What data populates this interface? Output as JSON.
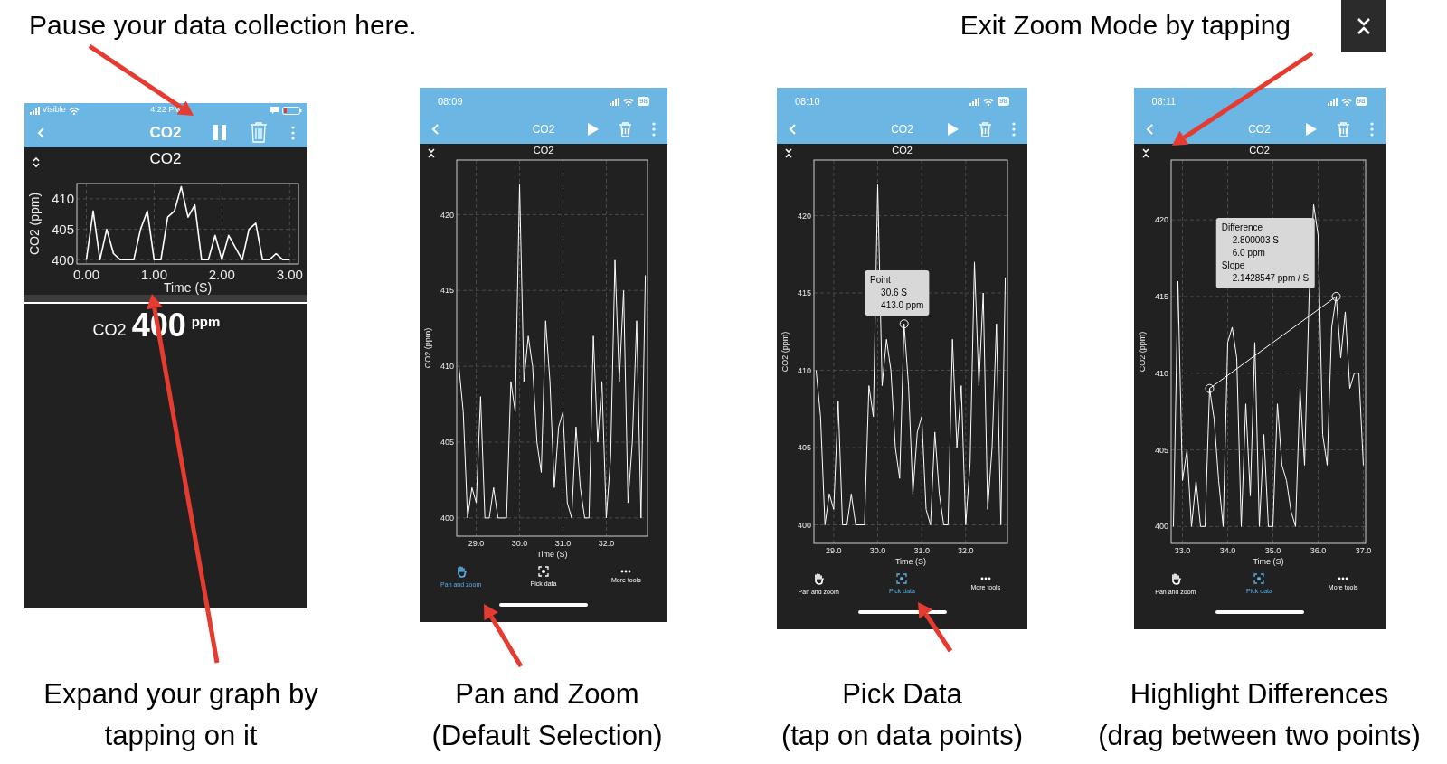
{
  "top_captions": [
    {
      "text": "Pause your data collection here."
    },
    {
      "text": "Exit Zoom Mode by tapping"
    }
  ],
  "screens": [
    {
      "kind": "live",
      "status_bar": {
        "carrier": "Visible",
        "time": "4:22 PM",
        "battery_low": true
      },
      "header": {
        "title": "CO2",
        "recording": true
      },
      "graph": {
        "expanded": false,
        "chart_data": {
          "type": "line",
          "title": "CO2",
          "xlabel": "Time (S)",
          "ylabel": "CO2 (ppm)",
          "grid": true,
          "x": [
            0,
            0.1,
            0.2,
            0.3,
            0.4,
            0.5,
            0.6,
            0.7,
            0.8,
            0.9,
            1.0,
            1.1,
            1.2,
            1.3,
            1.4,
            1.5,
            1.6,
            1.7,
            1.8,
            1.9,
            2.0,
            2.1,
            2.2,
            2.3,
            2.4,
            2.5,
            2.6,
            2.7,
            2.8,
            2.9,
            3.0
          ],
          "series": [
            {
              "color": "#ffffff",
              "values": [
                400,
                408,
                400,
                405,
                401,
                400,
                400,
                400,
                405,
                408,
                400,
                400,
                407,
                408,
                412,
                407,
                409,
                400,
                400,
                404,
                400,
                404,
                402,
                400,
                405,
                406,
                400,
                400,
                401,
                400,
                400
              ]
            }
          ],
          "xlim": [
            -0.14,
            3.13
          ],
          "ylim": [
            399.3,
            412.5
          ],
          "xticks": [
            {
              "value": 0,
              "label": "0.00"
            },
            {
              "value": 1,
              "label": "1.00"
            },
            {
              "value": 2,
              "label": "2.00"
            },
            {
              "value": 3,
              "label": "3.00"
            }
          ],
          "yticks": [
            {
              "value": 400,
              "label": "400"
            },
            {
              "value": 405,
              "label": "405"
            },
            {
              "value": 410,
              "label": "410"
            }
          ]
        }
      },
      "readout": {
        "label": "CO2",
        "value": "400",
        "unit": "ppm"
      }
    },
    {
      "kind": "zoomed",
      "status_bar": {
        "time": "08:09",
        "battery": "98",
        "battery_low": false
      },
      "header": {
        "title": "CO2",
        "recording": false
      },
      "graph": {
        "expanded": true,
        "chart_data": {
          "type": "line",
          "title": "CO2",
          "xlabel": "Time (S)",
          "ylabel": "CO2 (ppm)",
          "grid": true,
          "x": [
            28.6,
            28.7,
            28.8,
            28.9,
            29.0,
            29.1,
            29.2,
            29.3,
            29.4,
            29.5,
            29.6,
            29.7,
            29.8,
            29.9,
            30.0,
            30.1,
            30.2,
            30.3,
            30.4,
            30.5,
            30.6,
            30.7,
            30.8,
            30.9,
            31.0,
            31.1,
            31.2,
            31.3,
            31.4,
            31.5,
            31.6,
            31.7,
            31.8,
            31.9,
            32.0,
            32.1,
            32.2,
            32.3,
            32.4,
            32.5,
            32.6,
            32.7,
            32.8,
            32.9
          ],
          "series": [
            {
              "color": "#ffffff",
              "values": [
                410,
                407,
                400,
                402,
                401,
                408,
                400,
                400,
                402,
                400,
                400,
                400,
                409,
                407,
                422,
                409,
                412,
                410,
                405,
                403,
                413,
                409,
                402,
                406,
                407,
                401,
                400,
                406,
                402,
                400,
                400,
                412,
                405,
                409,
                400,
                404,
                417,
                409,
                415,
                401,
                405,
                413,
                400,
                416
              ]
            }
          ],
          "xlim": [
            28.55,
            32.95
          ],
          "ylim": [
            398.8,
            423.6
          ],
          "xticks": [
            {
              "value": 29,
              "label": "29.0"
            },
            {
              "value": 30,
              "label": "30.0"
            },
            {
              "value": 31,
              "label": "31.0"
            },
            {
              "value": 32,
              "label": "32.0"
            }
          ],
          "yticks": [
            {
              "value": 400,
              "label": "400"
            },
            {
              "value": 405,
              "label": "405"
            },
            {
              "value": 410,
              "label": "410"
            },
            {
              "value": 415,
              "label": "415"
            },
            {
              "value": 420,
              "label": "420"
            }
          ]
        }
      },
      "tools": [
        {
          "kind": "pan",
          "label": "Pan and zoom",
          "selected": true
        },
        {
          "kind": "pick",
          "label": "Pick data",
          "selected": false
        },
        {
          "kind": "more",
          "label": "More tools",
          "selected": false
        }
      ]
    },
    {
      "kind": "zoomed",
      "status_bar": {
        "time": "08:10",
        "battery": "98",
        "battery_low": false
      },
      "header": {
        "title": "CO2",
        "recording": false
      },
      "graph": {
        "expanded": true,
        "chart_data": {
          "type": "line",
          "title": "CO2",
          "xlabel": "Time (S)",
          "ylabel": "CO2 (ppm)",
          "grid": true,
          "x": [
            28.6,
            28.7,
            28.8,
            28.9,
            29.0,
            29.1,
            29.2,
            29.3,
            29.4,
            29.5,
            29.6,
            29.7,
            29.8,
            29.9,
            30.0,
            30.1,
            30.2,
            30.3,
            30.4,
            30.5,
            30.6,
            30.7,
            30.8,
            30.9,
            31.0,
            31.1,
            31.2,
            31.3,
            31.4,
            31.5,
            31.6,
            31.7,
            31.8,
            31.9,
            32.0,
            32.1,
            32.2,
            32.3,
            32.4,
            32.5,
            32.6,
            32.7,
            32.8,
            32.9
          ],
          "series": [
            {
              "color": "#ffffff",
              "values": [
                410,
                407,
                400,
                402,
                401,
                408,
                400,
                400,
                402,
                400,
                400,
                400,
                409,
                407,
                422,
                409,
                412,
                410,
                405,
                403,
                413,
                409,
                402,
                406,
                407,
                401,
                400,
                406,
                402,
                400,
                400,
                412,
                405,
                409,
                400,
                404,
                417,
                409,
                415,
                401,
                405,
                413,
                400,
                416
              ]
            },
            {
              "color": "#ffffff",
              "marker": true,
              "values": [
                null,
                null,
                null,
                null,
                null,
                null,
                null,
                null,
                null,
                null,
                null,
                null,
                null,
                null,
                null,
                null,
                null,
                null,
                null,
                null,
                413,
                null,
                null,
                null,
                null,
                null,
                null,
                null,
                null,
                null,
                null,
                null,
                null,
                null,
                null,
                null,
                null,
                null,
                null,
                null,
                null,
                null,
                null,
                null
              ]
            }
          ],
          "xlim": [
            28.55,
            32.95
          ],
          "ylim": [
            398.8,
            423.6
          ],
          "xticks": [
            {
              "value": 29,
              "label": "29.0"
            },
            {
              "value": 30,
              "label": "30.0"
            },
            {
              "value": 31,
              "label": "31.0"
            },
            {
              "value": 32,
              "label": "32.0"
            }
          ],
          "yticks": [
            {
              "value": 400,
              "label": "400"
            },
            {
              "value": 405,
              "label": "405"
            },
            {
              "value": 410,
              "label": "410"
            },
            {
              "value": 415,
              "label": "415"
            },
            {
              "value": 420,
              "label": "420"
            }
          ]
        },
        "popup": {
          "lines": [
            {
              "text": "Point",
              "indent": false
            },
            {
              "text": "30.6 S",
              "indent": true
            },
            {
              "text": "413.0 ppm",
              "indent": true
            }
          ]
        }
      },
      "tools": [
        {
          "kind": "pan",
          "label": "Pan and zoom",
          "selected": false
        },
        {
          "kind": "pick",
          "label": "Pick data",
          "selected": true
        },
        {
          "kind": "more",
          "label": "More tools",
          "selected": false
        }
      ]
    },
    {
      "kind": "zoomed",
      "status_bar": {
        "time": "08:11",
        "battery": "98",
        "battery_low": false
      },
      "header": {
        "title": "CO2",
        "recording": false
      },
      "graph": {
        "expanded": true,
        "chart_data": {
          "type": "line",
          "title": "CO2",
          "xlabel": "Time (S)",
          "ylabel": "CO2 (ppm)",
          "grid": true,
          "x": [
            32.8,
            32.9,
            33.0,
            33.1,
            33.2,
            33.3,
            33.4,
            33.5,
            33.6,
            33.7,
            33.8,
            33.9,
            34.0,
            34.1,
            34.2,
            34.3,
            34.4,
            34.5,
            34.6,
            34.7,
            34.8,
            34.9,
            35.0,
            35.1,
            35.2,
            35.3,
            35.4,
            35.5,
            35.6,
            35.7,
            35.8,
            35.9,
            36.0,
            36.1,
            36.2,
            36.3,
            36.4,
            36.5,
            36.6,
            36.7,
            36.8,
            36.9,
            37.0
          ],
          "series": [
            {
              "color": "#ffffff",
              "values": [
                400,
                416,
                403,
                405,
                400,
                403,
                400,
                400,
                409,
                407,
                403,
                400,
                412,
                413,
                411,
                400,
                408,
                402,
                412,
                400,
                406,
                400,
                400,
                408,
                404,
                403,
                401,
                400,
                409,
                404,
                415,
                421,
                419,
                406,
                404,
                413,
                415,
                411,
                414,
                409,
                410,
                410,
                404
              ]
            },
            {
              "color": "#ffffff",
              "marker": true,
              "values": [
                null,
                null,
                null,
                null,
                null,
                null,
                null,
                null,
                409,
                null,
                null,
                null,
                null,
                null,
                null,
                null,
                null,
                null,
                null,
                null,
                null,
                null,
                null,
                null,
                null,
                null,
                null,
                null,
                null,
                null,
                null,
                null,
                null,
                null,
                null,
                null,
                415,
                null,
                null,
                null,
                null,
                null,
                null
              ]
            }
          ],
          "xlim": [
            32.75,
            37.05
          ],
          "ylim": [
            398.9,
            423.9
          ],
          "xticks": [
            {
              "value": 33,
              "label": "33.0"
            },
            {
              "value": 34,
              "label": "34.0"
            },
            {
              "value": 35,
              "label": "35.0"
            },
            {
              "value": 36,
              "label": "36.0"
            },
            {
              "value": 37,
              "label": "37.0"
            }
          ],
          "yticks": [
            {
              "value": 400,
              "label": "400"
            },
            {
              "value": 405,
              "label": "405"
            },
            {
              "value": 410,
              "label": "410"
            },
            {
              "value": 415,
              "label": "415"
            },
            {
              "value": 420,
              "label": "420"
            }
          ]
        },
        "popup": {
          "lines": [
            {
              "text": "Difference",
              "indent": false
            },
            {
              "text": "2.800003 S",
              "indent": true
            },
            {
              "text": "6.0 ppm",
              "indent": true
            },
            {
              "text": "Slope",
              "indent": false
            },
            {
              "text": "2.1428547 ppm / S",
              "indent": true
            }
          ]
        }
      },
      "tools": [
        {
          "kind": "pan",
          "label": "Pan and zoom",
          "selected": false
        },
        {
          "kind": "pick",
          "label": "Pick data",
          "selected": true
        },
        {
          "kind": "more",
          "label": "More tools",
          "selected": false
        }
      ]
    }
  ],
  "bottom_captions": [
    {
      "text": "Expand your graph by\ntapping on it"
    },
    {
      "text": "Pan and Zoom\n(Default Selection)"
    },
    {
      "text": "Pick Data\n(tap on data points)"
    },
    {
      "text": "Highlight Differences\n(drag between two points)"
    }
  ]
}
